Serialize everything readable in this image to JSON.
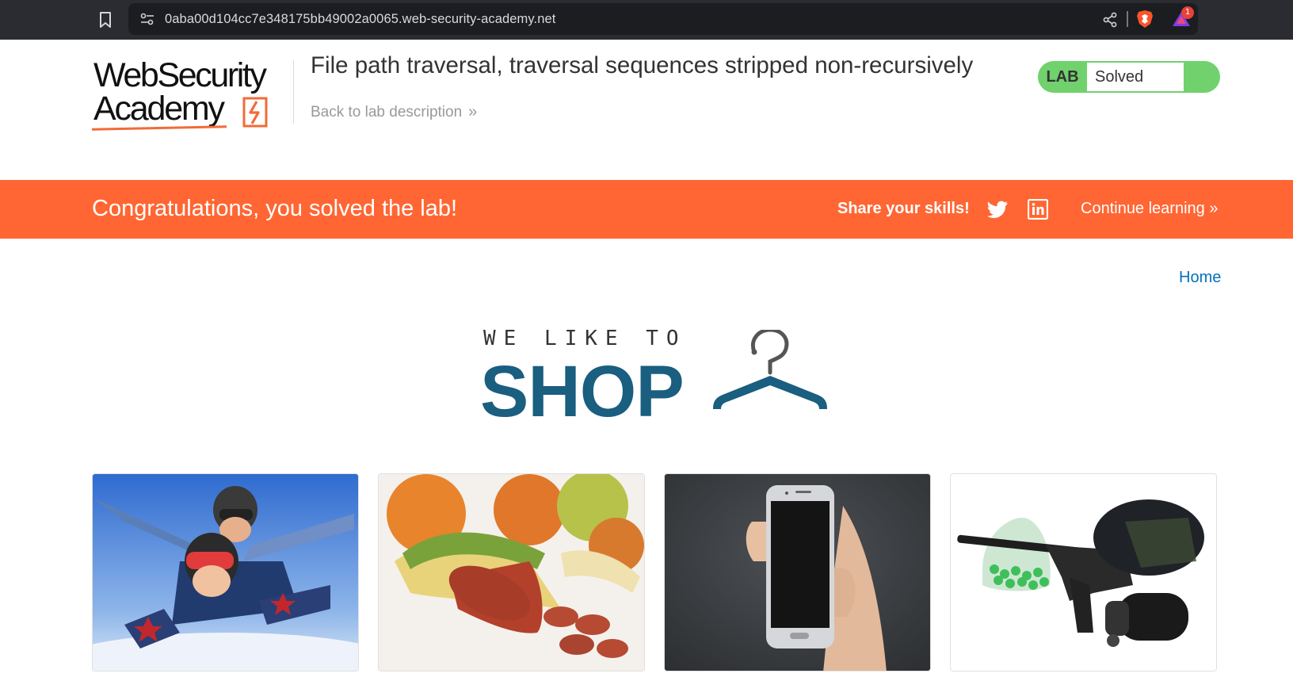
{
  "browser": {
    "url": "0aba00d104cc7e348175bb49002a0065.web-security-academy.net",
    "notification_count": "1"
  },
  "header": {
    "logo_line1": "WebSecurity",
    "logo_line2": "Academy",
    "lab_title": "File path traversal, traversal sequences stripped non-recursively",
    "back_link": "Back to lab description",
    "lab_tag": "LAB",
    "lab_status": "Solved",
    "lab_status_color": "#70d16d"
  },
  "banner": {
    "message": "Congratulations, you solved the lab!",
    "share_label": "Share your skills!",
    "continue_label": "Continue learning",
    "color": "#ff6633"
  },
  "nav": {
    "home_label": "Home"
  },
  "shop_logo": {
    "tagline": "WE LIKE TO",
    "word": "SHOP",
    "color": "#1a5e80"
  },
  "products": [
    {
      "image": "tandem-skydivers"
    },
    {
      "image": "sausage-in-banana-peel"
    },
    {
      "image": "hand-holding-smartphone"
    },
    {
      "image": "paintball-gun-and-mask"
    }
  ]
}
